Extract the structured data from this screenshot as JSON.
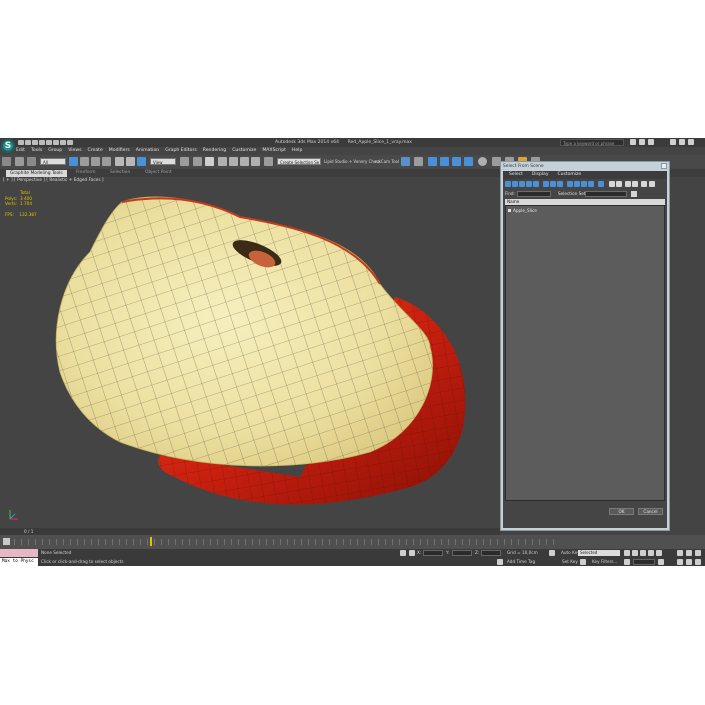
{
  "app": {
    "icon_letter": "S",
    "window_title": "Autodesk 3ds Max 2014 x64",
    "file_name": "Red_Apple_Slice_1_vray.max",
    "help_search_placeholder": "Type a keyword or phrase"
  },
  "menu": [
    "Edit",
    "Tools",
    "Group",
    "Views",
    "Create",
    "Modifiers",
    "Animation",
    "Graph Editors",
    "Rendering",
    "Customize",
    "MAXScript",
    "Help"
  ],
  "toolbar": {
    "filter_value": "All",
    "view_value": "View",
    "named_selection_value": "Create Selection Se",
    "text_items": [
      "Lipid Studio + Venery Check",
      "nz Cam Tool"
    ]
  },
  "ribbon_tabs": [
    "Graphite Modeling Tools",
    "Freeform",
    "Selection",
    "Object Paint"
  ],
  "viewport": {
    "label": "[ + ] [ Perspective ] [ Realistic + Edged Faces ]",
    "stats": {
      "header": "Total",
      "rows": [
        {
          "key": "Polys:",
          "value": "3 400"
        },
        {
          "key": "Verts:",
          "value": "1 704"
        }
      ],
      "fps_label": "FPS:",
      "fps_value": "132.387"
    }
  },
  "dialog": {
    "title": "Select From Scene",
    "menus": [
      "Select",
      "Display",
      "Customize"
    ],
    "find_label": "Find:",
    "selection_set_label": "Selection Set:",
    "column_header": "Name",
    "items": [
      "Apple_Slice"
    ],
    "ok_label": "OK",
    "cancel_label": "Cancel"
  },
  "trackbar": {
    "frame_label": "0 / 1"
  },
  "status": {
    "maxscript_text": "Max to Physc",
    "selection_text": "None Selected",
    "prompt_text": "Click or click-and-drag to select objects",
    "grid_text": "Grid = 10,0cm",
    "add_time_tag": "Add Time Tag",
    "auto_key": "Auto Key",
    "auto_key_value": "Selected",
    "set_key": "Set Key",
    "key_filters": "Key Filters..."
  },
  "colors": {
    "app_bg": "#444444",
    "stats_yellow": "#e3c300",
    "dialog_frame": "#c5d1da",
    "apple_flesh": "#efe4a2",
    "apple_skin": "#d22814"
  }
}
